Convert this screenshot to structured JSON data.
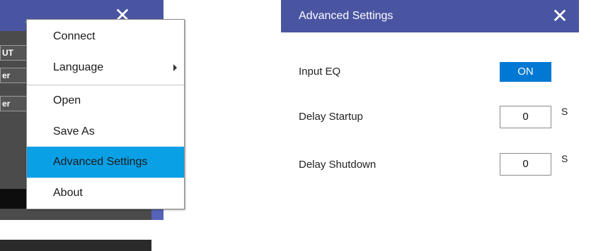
{
  "background_app": {
    "cells": [
      "UT",
      "er",
      "er"
    ],
    "close_icon": "close-icon"
  },
  "context_menu": {
    "items": [
      {
        "label": "Connect",
        "submenu": false
      },
      {
        "label": "Language",
        "submenu": true
      },
      {
        "label": "Open",
        "submenu": false
      },
      {
        "label": "Save As",
        "submenu": false
      },
      {
        "label": "Advanced Settings",
        "submenu": false,
        "highlighted": true
      },
      {
        "label": "About",
        "submenu": false
      }
    ],
    "highlight_color": "#0aa0e6"
  },
  "dialog": {
    "title": "Advanced Settings",
    "close_glyph": "✕",
    "titlebar_color": "#4a55a2",
    "settings": {
      "input_eq": {
        "label": "Input EQ",
        "value": "ON"
      },
      "delay_startup": {
        "label": "Delay Startup",
        "value": "0",
        "unit": "S"
      },
      "delay_shutdown": {
        "label": "Delay Shutdown",
        "value": "0",
        "unit": "S"
      }
    },
    "toggle_color": "#0078d4"
  }
}
